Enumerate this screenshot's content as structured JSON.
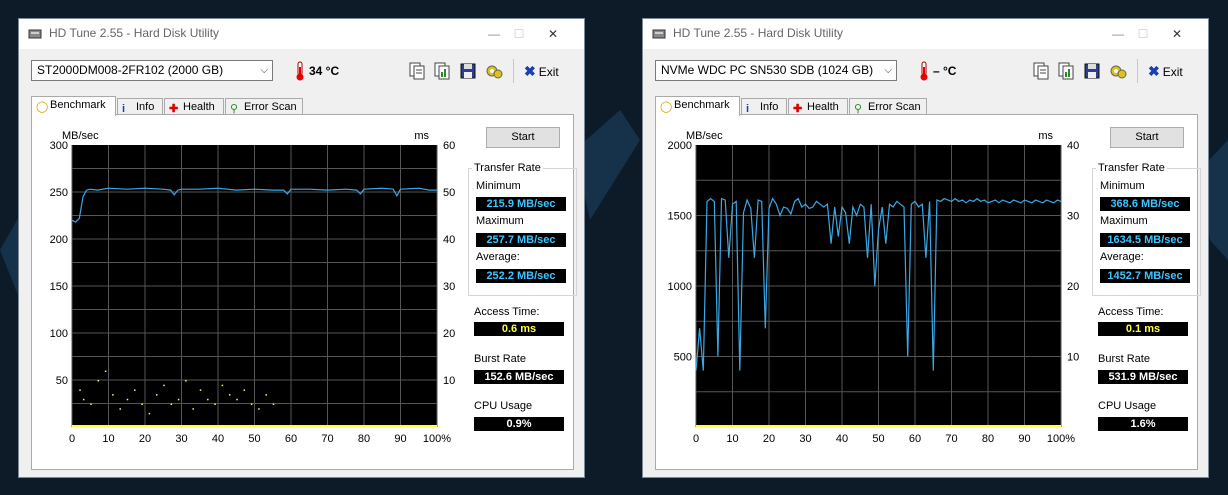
{
  "colors": {
    "curve": "#3aa8e6",
    "access": "#ffff40",
    "grid": "#555555"
  },
  "windows": [
    {
      "title": "HD Tune 2.55 - Hard Disk Utility",
      "controls": {
        "min": "—",
        "max": "☐",
        "close": "✕"
      },
      "drive": "ST2000DM008-2FR102 (2000 GB)",
      "temperature": "34 °C",
      "exit_label": "Exit",
      "tabs": [
        "Benchmark",
        "Info",
        "Health",
        "Error Scan"
      ],
      "start_label": "Start",
      "y_unit_left": "MB/sec",
      "y_unit_right": "ms",
      "transfer_rate": {
        "title": "Transfer Rate",
        "min_label": "Minimum",
        "min": "215.9 MB/sec",
        "max_label": "Maximum",
        "max": "257.7 MB/sec",
        "avg_label": "Average:",
        "avg": "252.2 MB/sec"
      },
      "access_label": "Access Time:",
      "access": "0.6 ms",
      "burst_label": "Burst Rate",
      "burst": "152.6 MB/sec",
      "cpu_label": "CPU Usage",
      "cpu": "0.9%",
      "chart_data": {
        "type": "line",
        "y_left_ticks": [
          "300",
          "250",
          "200",
          "150",
          "100",
          "50"
        ],
        "y_right_ticks": [
          "60",
          "50",
          "40",
          "30",
          "20",
          "10"
        ],
        "x_ticks": [
          "0",
          "10",
          "20",
          "30",
          "40",
          "50",
          "60",
          "70",
          "80",
          "90",
          "100%"
        ],
        "ylim": [
          0,
          300
        ],
        "y2lim": [
          0,
          60
        ],
        "xlim": [
          0,
          100
        ],
        "series": [
          {
            "values": [
              [
                0,
                220
              ],
              [
                1,
                218
              ],
              [
                2,
                222
              ],
              [
                3,
                245
              ],
              [
                4,
                252
              ],
              [
                5,
                253
              ],
              [
                7,
                252
              ],
              [
                10,
                254
              ],
              [
                15,
                253
              ],
              [
                20,
                254
              ],
              [
                25,
                253
              ],
              [
                27,
                252
              ],
              [
                28,
                247
              ],
              [
                29,
                252
              ],
              [
                30,
                253
              ],
              [
                35,
                253
              ],
              [
                40,
                254
              ],
              [
                45,
                252
              ],
              [
                50,
                253
              ],
              [
                55,
                252
              ],
              [
                58,
                252
              ],
              [
                59,
                248
              ],
              [
                60,
                253
              ],
              [
                65,
                253
              ],
              [
                70,
                252
              ],
              [
                75,
                253
              ],
              [
                78,
                252
              ],
              [
                79,
                248
              ],
              [
                80,
                253
              ],
              [
                85,
                254
              ],
              [
                88,
                253
              ],
              [
                89,
                246
              ],
              [
                90,
                253
              ],
              [
                95,
                254
              ],
              [
                98,
                252
              ],
              [
                100,
                252
              ]
            ]
          }
        ],
        "access_points": [
          [
            2,
            8
          ],
          [
            3,
            6
          ],
          [
            5,
            5
          ],
          [
            7,
            10
          ],
          [
            9,
            12
          ],
          [
            11,
            7
          ],
          [
            13,
            4
          ],
          [
            15,
            6
          ],
          [
            17,
            8
          ],
          [
            19,
            5
          ],
          [
            21,
            3
          ],
          [
            23,
            7
          ],
          [
            25,
            9
          ],
          [
            27,
            5
          ],
          [
            29,
            6
          ],
          [
            31,
            10
          ],
          [
            33,
            4
          ],
          [
            35,
            8
          ],
          [
            37,
            6
          ],
          [
            39,
            5
          ],
          [
            41,
            9
          ],
          [
            43,
            7
          ],
          [
            45,
            6
          ],
          [
            47,
            8
          ],
          [
            49,
            5
          ],
          [
            51,
            4
          ],
          [
            53,
            7
          ],
          [
            55,
            5
          ]
        ]
      }
    },
    {
      "title": "HD Tune 2.55 - Hard Disk Utility",
      "controls": {
        "min": "—",
        "max": "☐",
        "close": "✕"
      },
      "drive": "NVMe    WDC PC SN530 SDB (1024 GB)",
      "temperature": "– °C",
      "exit_label": "Exit",
      "tabs": [
        "Benchmark",
        "Info",
        "Health",
        "Error Scan"
      ],
      "start_label": "Start",
      "y_unit_left": "MB/sec",
      "y_unit_right": "ms",
      "transfer_rate": {
        "title": "Transfer Rate",
        "min_label": "Minimum",
        "min": "368.6 MB/sec",
        "max_label": "Maximum",
        "max": "1634.5 MB/sec",
        "avg_label": "Average:",
        "avg": "1452.7 MB/sec"
      },
      "access_label": "Access Time:",
      "access": "0.1 ms",
      "burst_label": "Burst Rate",
      "burst": "531.9 MB/sec",
      "cpu_label": "CPU Usage",
      "cpu": "1.6%",
      "chart_data": {
        "type": "line",
        "y_left_ticks": [
          "2000",
          "1500",
          "1000",
          "500"
        ],
        "y_right_ticks": [
          "40",
          "30",
          "20",
          "10"
        ],
        "x_ticks": [
          "0",
          "10",
          "20",
          "30",
          "40",
          "50",
          "60",
          "70",
          "80",
          "90",
          "100%"
        ],
        "ylim": [
          0,
          2000
        ],
        "y2lim": [
          0,
          40
        ],
        "xlim": [
          0,
          100
        ],
        "series": [
          {
            "values": [
              [
                0,
                400
              ],
              [
                1,
                700
              ],
              [
                2,
                400
              ],
              [
                3,
                1600
              ],
              [
                4,
                1620
              ],
              [
                5,
                1600
              ],
              [
                6,
                500
              ],
              [
                7,
                1620
              ],
              [
                8,
                1610
              ],
              [
                9,
                1200
              ],
              [
                10,
                1580
              ],
              [
                11,
                1600
              ],
              [
                12,
                400
              ],
              [
                13,
                1520
              ],
              [
                14,
                1610
              ],
              [
                15,
                1550
              ],
              [
                16,
                1200
              ],
              [
                17,
                1610
              ],
              [
                18,
                1600
              ],
              [
                19,
                700
              ],
              [
                20,
                1550
              ],
              [
                21,
                1620
              ],
              [
                22,
                1580
              ],
              [
                23,
                1500
              ],
              [
                24,
                1560
              ],
              [
                25,
                1550
              ],
              [
                26,
                1510
              ],
              [
                27,
                1600
              ],
              [
                28,
                1620
              ],
              [
                29,
                1560
              ],
              [
                30,
                1580
              ],
              [
                31,
                1550
              ],
              [
                32,
                1560
              ],
              [
                33,
                1600
              ],
              [
                34,
                1580
              ],
              [
                35,
                1560
              ],
              [
                36,
                1580
              ],
              [
                37,
                1300
              ],
              [
                38,
                1560
              ],
              [
                39,
                1350
              ],
              [
                40,
                1560
              ],
              [
                41,
                1520
              ],
              [
                42,
                1300
              ],
              [
                43,
                1560
              ],
              [
                44,
                1500
              ],
              [
                45,
                1580
              ],
              [
                46,
                1560
              ],
              [
                47,
                1200
              ],
              [
                48,
                1580
              ],
              [
                49,
                1000
              ],
              [
                50,
                1400
              ],
              [
                51,
                1560
              ],
              [
                52,
                1300
              ],
              [
                53,
                1580
              ],
              [
                54,
                1560
              ],
              [
                55,
                1600
              ],
              [
                56,
                1580
              ],
              [
                57,
                1560
              ],
              [
                58,
                500
              ],
              [
                59,
                1580
              ],
              [
                60,
                1600
              ],
              [
                61,
                1560
              ],
              [
                62,
                1580
              ],
              [
                63,
                1200
              ],
              [
                64,
                1600
              ],
              [
                65,
                400
              ],
              [
                66,
                1610
              ],
              [
                67,
                1600
              ],
              [
                68,
                1620
              ],
              [
                69,
                1610
              ],
              [
                70,
                1600
              ],
              [
                71,
                1620
              ],
              [
                72,
                1600
              ],
              [
                73,
                1610
              ],
              [
                74,
                1590
              ],
              [
                75,
                1610
              ],
              [
                76,
                1600
              ],
              [
                77,
                1620
              ],
              [
                78,
                1600
              ],
              [
                79,
                1610
              ],
              [
                80,
                1590
              ],
              [
                81,
                1600
              ],
              [
                82,
                1610
              ],
              [
                83,
                1590
              ],
              [
                84,
                1610
              ],
              [
                85,
                1600
              ],
              [
                86,
                1590
              ],
              [
                87,
                1610
              ],
              [
                88,
                1600
              ],
              [
                89,
                1590
              ],
              [
                90,
                1610
              ],
              [
                91,
                1600
              ],
              [
                92,
                1590
              ],
              [
                93,
                1610
              ],
              [
                94,
                1600
              ],
              [
                95,
                1590
              ],
              [
                96,
                1610
              ],
              [
                97,
                1600
              ],
              [
                98,
                1590
              ],
              [
                99,
                1610
              ],
              [
                100,
                1600
              ]
            ]
          }
        ],
        "access_points": []
      }
    }
  ]
}
